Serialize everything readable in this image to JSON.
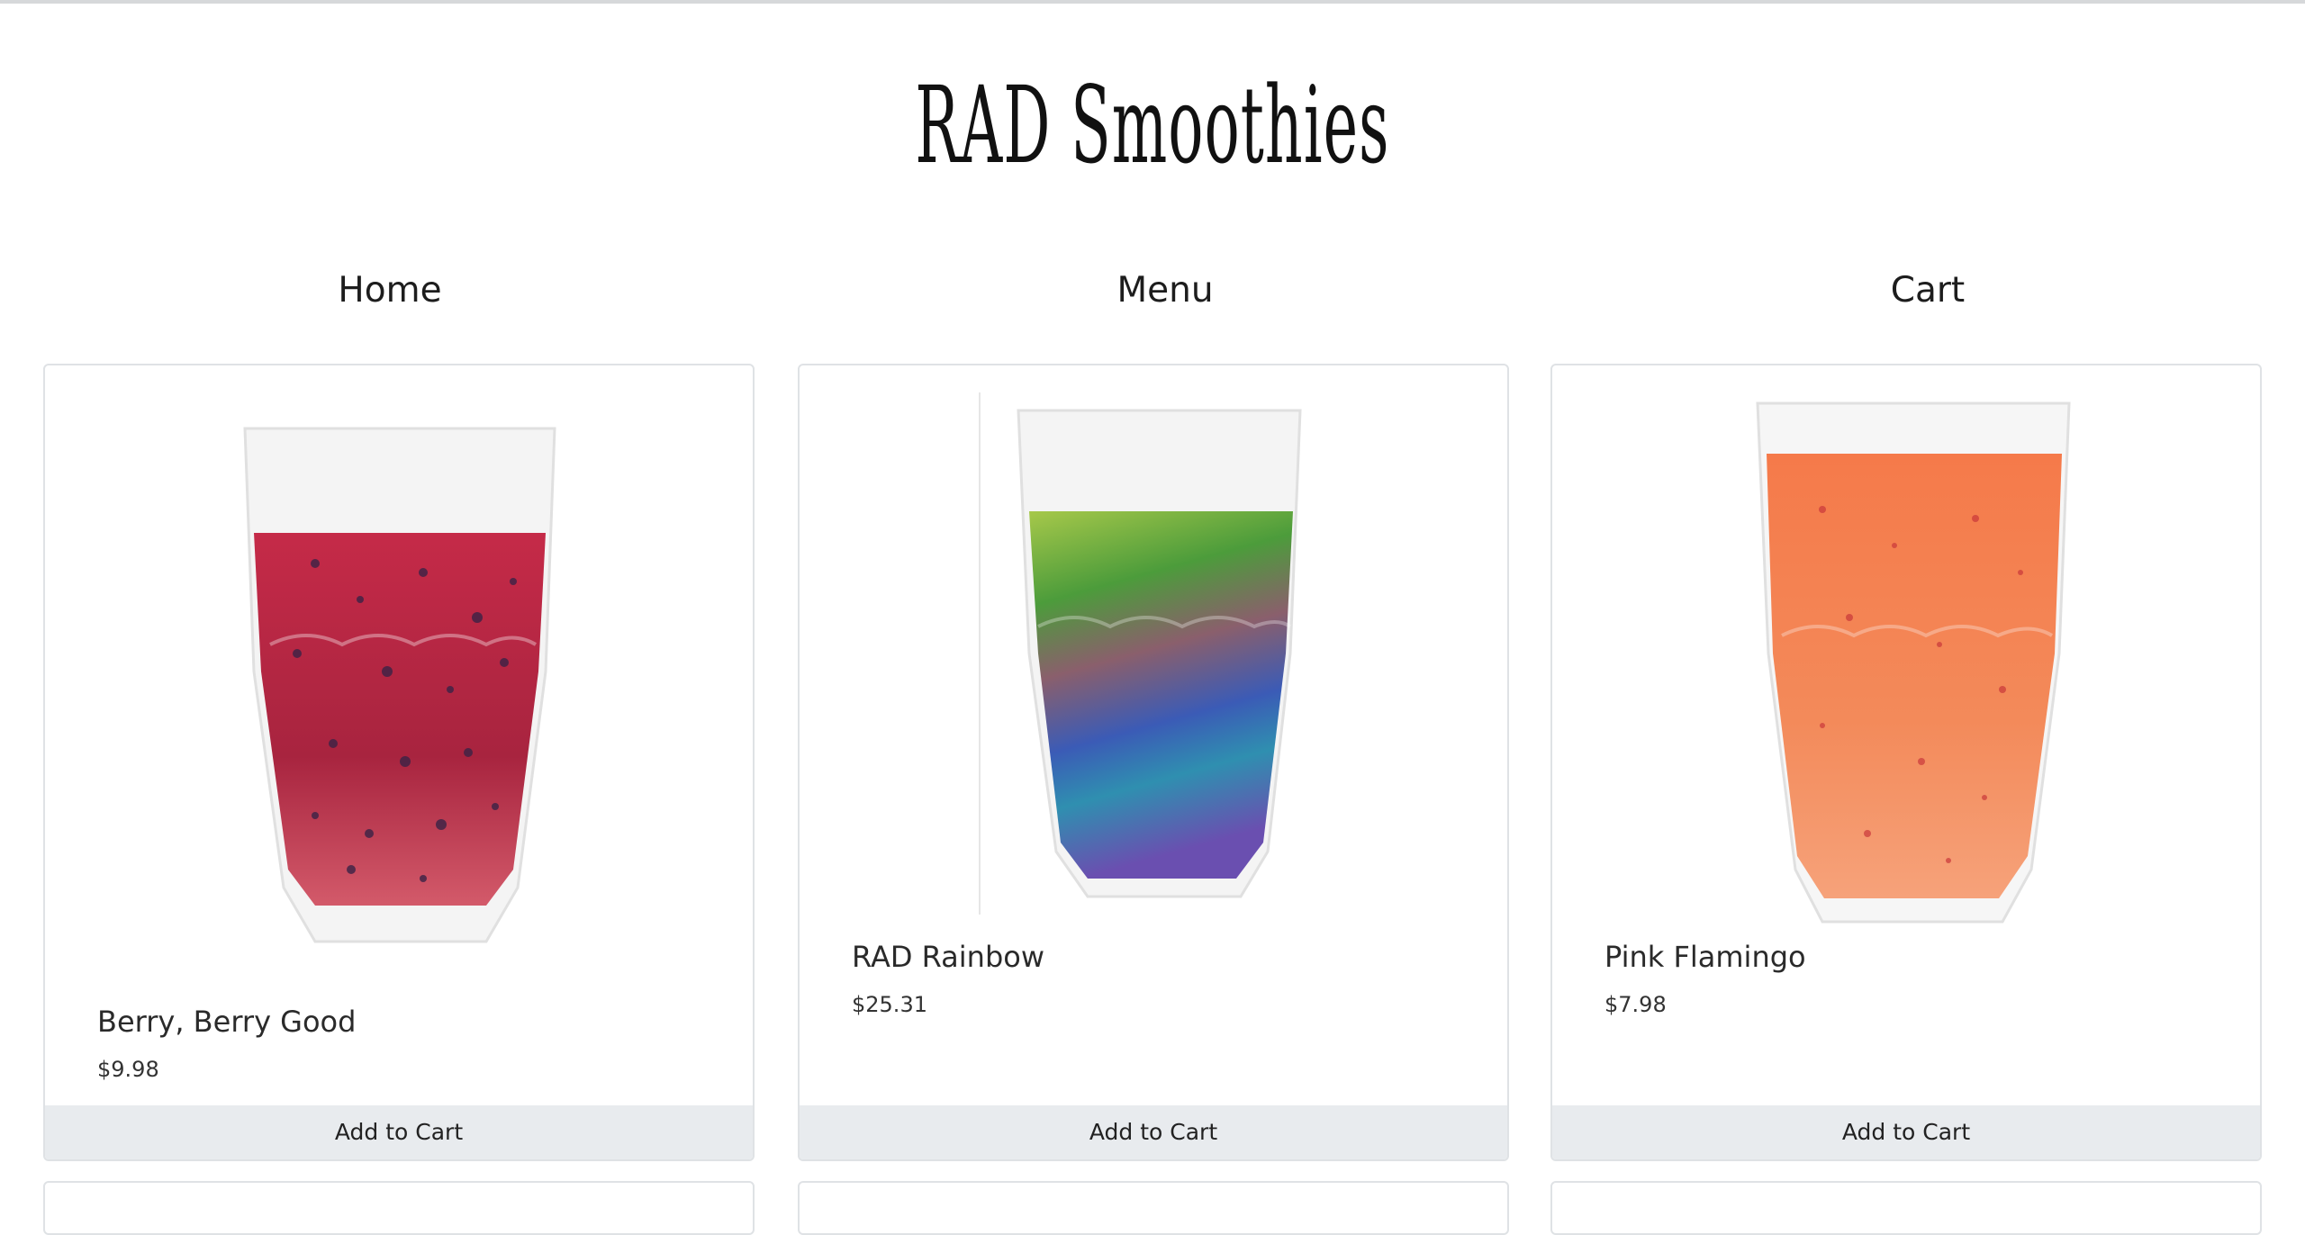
{
  "site": {
    "title": "RAD Smoothies"
  },
  "nav": {
    "home": "Home",
    "menu": "Menu",
    "cart": "Cart"
  },
  "products": [
    {
      "name": "Berry, Berry Good",
      "price": "$9.98",
      "button": "Add to Cart",
      "image": "berry-smoothie-glass"
    },
    {
      "name": "RAD Rainbow",
      "price": "$25.31",
      "button": "Add to Cart",
      "image": "rainbow-smoothie-glass"
    },
    {
      "name": "Pink Flamingo",
      "price": "$7.98",
      "button": "Add to Cart",
      "image": "pink-flamingo-smoothie-glass"
    }
  ],
  "colors": {
    "button_bg": "#e8ebee",
    "card_border": "#dfe2e5",
    "berry": "#b4283f",
    "flamingo": "#f2784b"
  }
}
